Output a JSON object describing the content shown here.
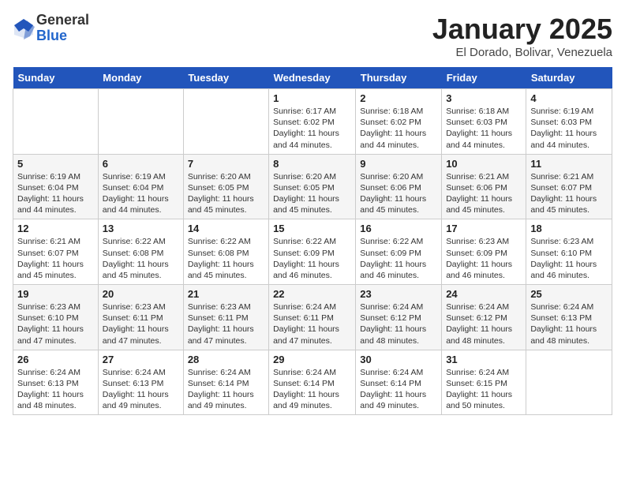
{
  "header": {
    "logo_line1": "General",
    "logo_line2": "Blue",
    "month_title": "January 2025",
    "location": "El Dorado, Bolivar, Venezuela"
  },
  "weekdays": [
    "Sunday",
    "Monday",
    "Tuesday",
    "Wednesday",
    "Thursday",
    "Friday",
    "Saturday"
  ],
  "weeks": [
    [
      {
        "day": "",
        "info": ""
      },
      {
        "day": "",
        "info": ""
      },
      {
        "day": "",
        "info": ""
      },
      {
        "day": "1",
        "info": "Sunrise: 6:17 AM\nSunset: 6:02 PM\nDaylight: 11 hours and 44 minutes."
      },
      {
        "day": "2",
        "info": "Sunrise: 6:18 AM\nSunset: 6:02 PM\nDaylight: 11 hours and 44 minutes."
      },
      {
        "day": "3",
        "info": "Sunrise: 6:18 AM\nSunset: 6:03 PM\nDaylight: 11 hours and 44 minutes."
      },
      {
        "day": "4",
        "info": "Sunrise: 6:19 AM\nSunset: 6:03 PM\nDaylight: 11 hours and 44 minutes."
      }
    ],
    [
      {
        "day": "5",
        "info": "Sunrise: 6:19 AM\nSunset: 6:04 PM\nDaylight: 11 hours and 44 minutes."
      },
      {
        "day": "6",
        "info": "Sunrise: 6:19 AM\nSunset: 6:04 PM\nDaylight: 11 hours and 44 minutes."
      },
      {
        "day": "7",
        "info": "Sunrise: 6:20 AM\nSunset: 6:05 PM\nDaylight: 11 hours and 45 minutes."
      },
      {
        "day": "8",
        "info": "Sunrise: 6:20 AM\nSunset: 6:05 PM\nDaylight: 11 hours and 45 minutes."
      },
      {
        "day": "9",
        "info": "Sunrise: 6:20 AM\nSunset: 6:06 PM\nDaylight: 11 hours and 45 minutes."
      },
      {
        "day": "10",
        "info": "Sunrise: 6:21 AM\nSunset: 6:06 PM\nDaylight: 11 hours and 45 minutes."
      },
      {
        "day": "11",
        "info": "Sunrise: 6:21 AM\nSunset: 6:07 PM\nDaylight: 11 hours and 45 minutes."
      }
    ],
    [
      {
        "day": "12",
        "info": "Sunrise: 6:21 AM\nSunset: 6:07 PM\nDaylight: 11 hours and 45 minutes."
      },
      {
        "day": "13",
        "info": "Sunrise: 6:22 AM\nSunset: 6:08 PM\nDaylight: 11 hours and 45 minutes."
      },
      {
        "day": "14",
        "info": "Sunrise: 6:22 AM\nSunset: 6:08 PM\nDaylight: 11 hours and 45 minutes."
      },
      {
        "day": "15",
        "info": "Sunrise: 6:22 AM\nSunset: 6:09 PM\nDaylight: 11 hours and 46 minutes."
      },
      {
        "day": "16",
        "info": "Sunrise: 6:22 AM\nSunset: 6:09 PM\nDaylight: 11 hours and 46 minutes."
      },
      {
        "day": "17",
        "info": "Sunrise: 6:23 AM\nSunset: 6:09 PM\nDaylight: 11 hours and 46 minutes."
      },
      {
        "day": "18",
        "info": "Sunrise: 6:23 AM\nSunset: 6:10 PM\nDaylight: 11 hours and 46 minutes."
      }
    ],
    [
      {
        "day": "19",
        "info": "Sunrise: 6:23 AM\nSunset: 6:10 PM\nDaylight: 11 hours and 47 minutes."
      },
      {
        "day": "20",
        "info": "Sunrise: 6:23 AM\nSunset: 6:11 PM\nDaylight: 11 hours and 47 minutes."
      },
      {
        "day": "21",
        "info": "Sunrise: 6:23 AM\nSunset: 6:11 PM\nDaylight: 11 hours and 47 minutes."
      },
      {
        "day": "22",
        "info": "Sunrise: 6:24 AM\nSunset: 6:11 PM\nDaylight: 11 hours and 47 minutes."
      },
      {
        "day": "23",
        "info": "Sunrise: 6:24 AM\nSunset: 6:12 PM\nDaylight: 11 hours and 48 minutes."
      },
      {
        "day": "24",
        "info": "Sunrise: 6:24 AM\nSunset: 6:12 PM\nDaylight: 11 hours and 48 minutes."
      },
      {
        "day": "25",
        "info": "Sunrise: 6:24 AM\nSunset: 6:13 PM\nDaylight: 11 hours and 48 minutes."
      }
    ],
    [
      {
        "day": "26",
        "info": "Sunrise: 6:24 AM\nSunset: 6:13 PM\nDaylight: 11 hours and 48 minutes."
      },
      {
        "day": "27",
        "info": "Sunrise: 6:24 AM\nSunset: 6:13 PM\nDaylight: 11 hours and 49 minutes."
      },
      {
        "day": "28",
        "info": "Sunrise: 6:24 AM\nSunset: 6:14 PM\nDaylight: 11 hours and 49 minutes."
      },
      {
        "day": "29",
        "info": "Sunrise: 6:24 AM\nSunset: 6:14 PM\nDaylight: 11 hours and 49 minutes."
      },
      {
        "day": "30",
        "info": "Sunrise: 6:24 AM\nSunset: 6:14 PM\nDaylight: 11 hours and 49 minutes."
      },
      {
        "day": "31",
        "info": "Sunrise: 6:24 AM\nSunset: 6:15 PM\nDaylight: 11 hours and 50 minutes."
      },
      {
        "day": "",
        "info": ""
      }
    ]
  ]
}
